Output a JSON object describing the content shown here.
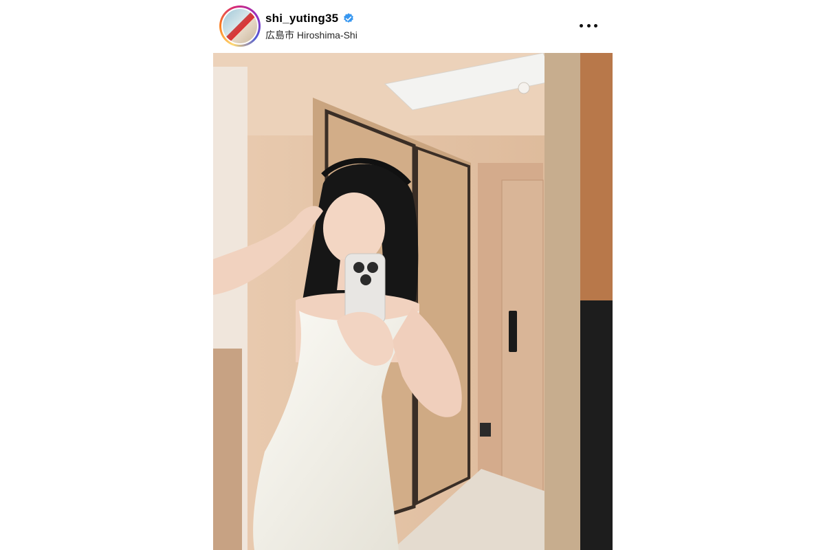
{
  "post": {
    "username": "shi_yuting35",
    "verified": true,
    "location": "広島市 Hiroshima-Shi"
  },
  "colors": {
    "verified_badge": "#3897f0",
    "wall": "#e6c7ab",
    "dress": "#f3f1ea",
    "hair": "#161616"
  },
  "icons": {
    "verified": "verified-badge-icon",
    "more": "more-options-icon"
  }
}
